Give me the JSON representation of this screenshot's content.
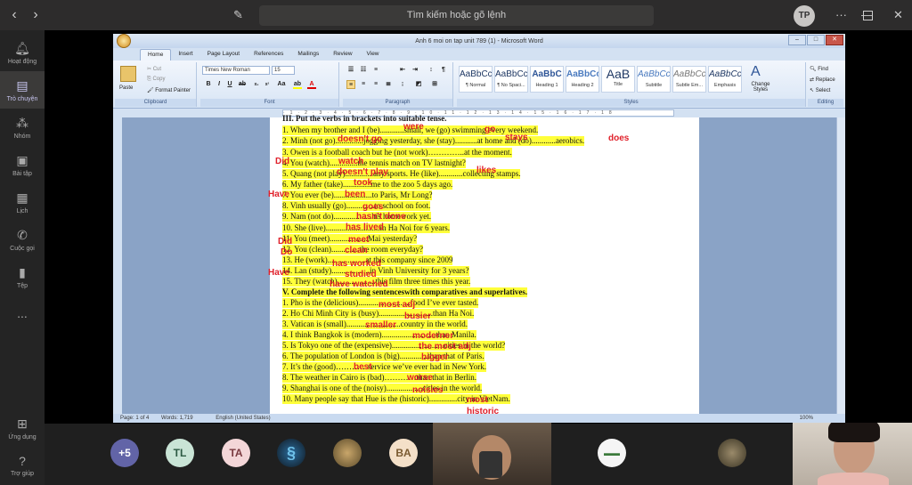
{
  "teams": {
    "search_placeholder": "Tìm kiếm hoặc gõ lệnh",
    "user_initials": "TP",
    "rail": [
      {
        "icon": "bell-icon",
        "label": "Hoạt động"
      },
      {
        "icon": "chat-icon",
        "label": "Trò chuyện"
      },
      {
        "icon": "teams-icon",
        "label": "Nhóm"
      },
      {
        "icon": "assignments-icon",
        "label": "Bài tập"
      },
      {
        "icon": "calendar-icon",
        "label": "Lịch"
      },
      {
        "icon": "calls-icon",
        "label": "Cuộc gọi"
      },
      {
        "icon": "files-icon",
        "label": "Tệp"
      },
      {
        "icon": "more-icon",
        "label": "..."
      },
      {
        "icon": "apps-icon",
        "label": "Ứng dụng"
      },
      {
        "icon": "help-icon",
        "label": "Trợ giúp"
      }
    ],
    "participants": [
      {
        "label": "+5",
        "bg": "#6264a7",
        "fg": "#ffffff"
      },
      {
        "label": "TL",
        "bg": "#c9e4d6",
        "fg": "#2d5a44"
      },
      {
        "label": "TA",
        "bg": "#f3d6d8",
        "fg": "#7a3a40"
      },
      {
        "label": "",
        "bg": "#1f1f1f",
        "fg": "#6ec0e8"
      },
      {
        "label": "",
        "bg": "#8a7a5a",
        "fg": "#ffffff"
      },
      {
        "label": "BA",
        "bg": "#f4e0c8",
        "fg": "#7a5a30"
      },
      {
        "label": "",
        "bg": "#f5f5f5",
        "fg": "#3a7a3a"
      },
      {
        "label": "",
        "bg": "#4a4a3a",
        "fg": "#ffffff"
      }
    ]
  },
  "word": {
    "title": "Anh 6 moi on tap unit 789 (1) - Microsoft Word",
    "tabs": [
      "Home",
      "Insert",
      "Page Layout",
      "References",
      "Mailings",
      "Review",
      "View"
    ],
    "clipboard": {
      "paste": "Paste",
      "cut": "Cut",
      "copy": "Copy",
      "format_painter": "Format Painter",
      "label": "Clipboard"
    },
    "font": {
      "name": "Times New Roman",
      "size": "15",
      "label": "Font"
    },
    "paragraph_label": "Paragraph",
    "styles": [
      {
        "sample": "AaBbCcI",
        "name": "¶ Normal"
      },
      {
        "sample": "AaBbCcI",
        "name": "¶ No Spaci..."
      },
      {
        "sample": "AaBbC",
        "name": "Heading 1"
      },
      {
        "sample": "AaBbCc",
        "name": "Heading 2"
      },
      {
        "sample": "AaB",
        "name": "Title"
      },
      {
        "sample": "AaBbCc.",
        "name": "Subtitle"
      },
      {
        "sample": "AaBbCcD",
        "name": "Subtle Em..."
      },
      {
        "sample": "AaBbCcD",
        "name": "Emphasis"
      }
    ],
    "styles_label": "Styles",
    "change_styles": "Change Styles",
    "editing": {
      "find": "Find",
      "replace": "Replace",
      "select": "Select",
      "label": "Editing"
    },
    "status": {
      "page": "Page: 1 of 4",
      "words": "Words: 1,719",
      "language": "English (United States)",
      "zoom": "100%"
    }
  },
  "doc": {
    "lines": [
      {
        "text": "III. Put the verbs in brackets into suitable tense.",
        "bold": true
      },
      {
        "text": "1. When my brother and I (be)............small, we            (go) swimming every weekend."
      },
      {
        "text": "2. Minh (not go)..............jogging yesterday, she (stay)...........at home and (do)............aerobics."
      },
      {
        "text": "3. Owen is a football coach but he (not work)…………..at the moment."
      },
      {
        "text": "4. You (watch)..............the tennis match on TV lastnight?"
      },
      {
        "text": "5. Quang (not play)..............any sports. He (like)............collecting stamps."
      },
      {
        "text": "6. My father (take)..............me to the zoo 5 days ago."
      },
      {
        "text": "7. You ever (be)...................to Paris, Mr Long?"
      },
      {
        "text": "8. Vinh usually (go)..............to school on foot."
      },
      {
        "text": "9. Nam (not do)...................his homework yet."
      },
      {
        "text": "10. She (live)...........................in Ha Noi for 6 years."
      },
      {
        "text": "11. You (meet)...................Mai yesterday?"
      },
      {
        "text": "12. You (clean)..............the room everyday?"
      },
      {
        "text": "13. He (work)...................at this company since 2009"
      },
      {
        "text": "14. Lan (study)...................in Vinh University for 3 years?"
      },
      {
        "text": "15. They (watch)...................this film three times this year."
      },
      {
        "text": "V. Complete the following sentenceswith comparatives and superlatives.",
        "bold": true
      },
      {
        "text": "1. Pho is the (delicious)..........................food I’ve ever tasted."
      },
      {
        "text": "2. Ho Chi Minh City is (busy)...........................than Ha Noi."
      },
      {
        "text": "3. Vatican is (small)...........................country in the world."
      },
      {
        "text": "4. I think Bangkok is (modern)...........................than Manila."
      },
      {
        "text": "5. Is Tokyo one of the (expensive)..........................cities in the world?"
      },
      {
        "text": "6. The population of London is (big)..............than that of Paris."
      },
      {
        "text": "7. It’s the (good)…………service we’ve ever had in New York."
      },
      {
        "text": "8. The weather in Cairo is (bad)…………than that in Berlin."
      },
      {
        "text": "9. Shanghai is one of the (noisy)..................cities in the world."
      },
      {
        "text": "10. Many people say that Hue is the (historic)..............city in VietNam."
      }
    ],
    "answers": [
      "were",
      "go",
      "doesn't go",
      "stays",
      "does",
      "Did",
      "watch",
      "doesn't play",
      "likes",
      "took",
      "Have",
      "been",
      "goes",
      "hasn't done",
      "has lived",
      "Did",
      "meet",
      "Do",
      "clean",
      "has worked",
      "studied",
      "Have",
      "have watched",
      "most adj",
      "busier",
      "smaller",
      "moderner",
      "the most adj",
      "bigger",
      "best",
      "worse",
      "noisies",
      "most",
      "historic"
    ]
  }
}
